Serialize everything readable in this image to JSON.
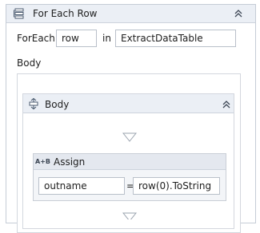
{
  "foreach": {
    "title": "For Each Row",
    "keyword_label": "ForEach",
    "item_value": "row",
    "in_label": "in",
    "collection_value": "ExtractDataTable",
    "body_label": "Body"
  },
  "sequence": {
    "title": "Body"
  },
  "assign": {
    "icon_text": "A+B",
    "title": "Assign",
    "to_value": "outname",
    "equals": "=",
    "value": "row(0).ToString"
  },
  "icons": [
    "sequence-icon",
    "collapse-icon",
    "drop-arrow-icon",
    "assign-icon"
  ],
  "colors": {
    "header_bg": "#ebeff5",
    "border": "#c5ccd6",
    "arrow": "#9aa3ae"
  }
}
